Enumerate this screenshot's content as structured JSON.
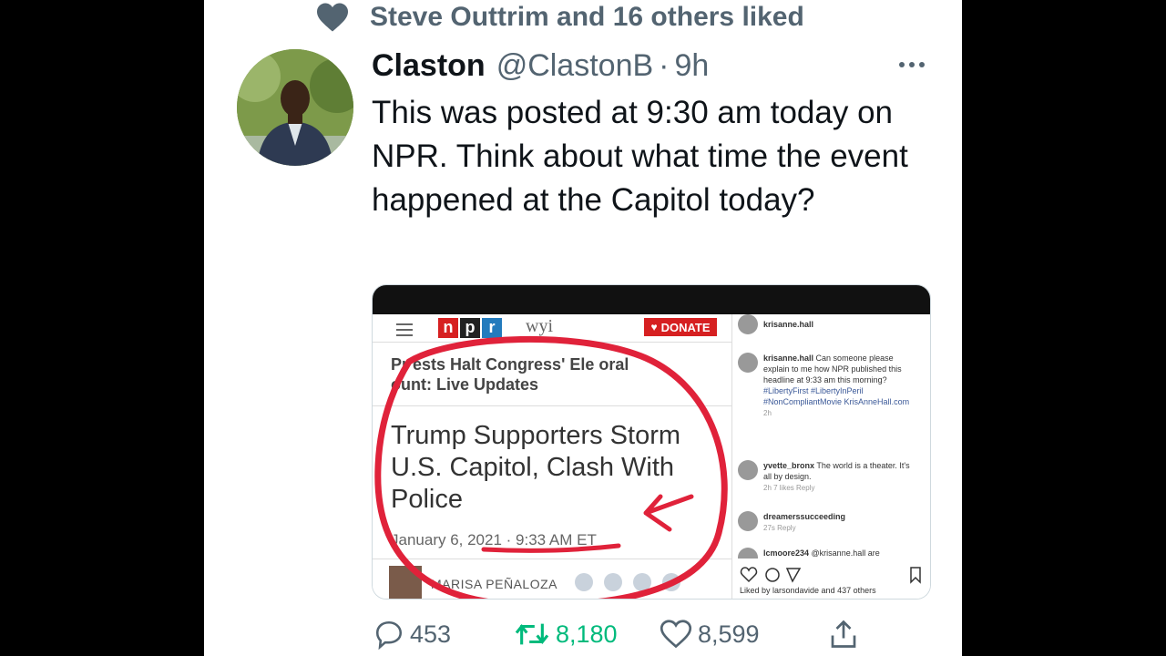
{
  "social_context": {
    "liked_text": "Steve Outtrim and 16 others liked"
  },
  "tweet": {
    "author_name": "Claston",
    "author_handle": "@ClastonB",
    "separator": "·",
    "age": "9h",
    "more": "•••",
    "text": "This was posted at 9:30 am today on NPR. Think about what time the event happened at the Capitol today?",
    "replies": "453",
    "retweets": "8,180",
    "likes": "8,599"
  },
  "media": {
    "npr": {
      "logo": [
        "n",
        "p",
        "r"
      ],
      "station": "wyi",
      "donate_label": "DONATE",
      "live_headline": "Pr  ests Halt Congress' Ele   oral\n  ount: Live Updates",
      "story_title": "Trump Supporters Storm U.S. Capitol, Clash With Police",
      "date": "January 6, 2021 · 9:33 AM ET",
      "byline": "MARISA PEÑALOZA"
    },
    "instagram": {
      "header_user": "krisanne.hall",
      "comments": [
        {
          "user": "krisanne.hall",
          "text": "Can someone please explain to me how NPR published this headline at 9:33 am this morning?",
          "extra": "#LibertyFirst #LibertyInPeril #NonCompliantMovie KrisAnneHall.com",
          "meta": "2h"
        },
        {
          "user": "yvette_bronx",
          "text": "The world is a theater. It's all by design.",
          "extra": "",
          "meta": "2h   7 likes   Reply"
        },
        {
          "user": "dreamerssucceeding",
          "text": "",
          "extra": "",
          "meta": "27s   Reply"
        },
        {
          "user": "lcmoore234",
          "text": "@krisanne.hall are",
          "extra": "",
          "meta": ""
        }
      ],
      "liked_by": "Liked by larsondavide and 437 others"
    }
  },
  "colors": {
    "npr_red": "#d62021",
    "circle_red": "#e0223a",
    "retweet_green": "#00ba7c",
    "muted": "#536471"
  }
}
